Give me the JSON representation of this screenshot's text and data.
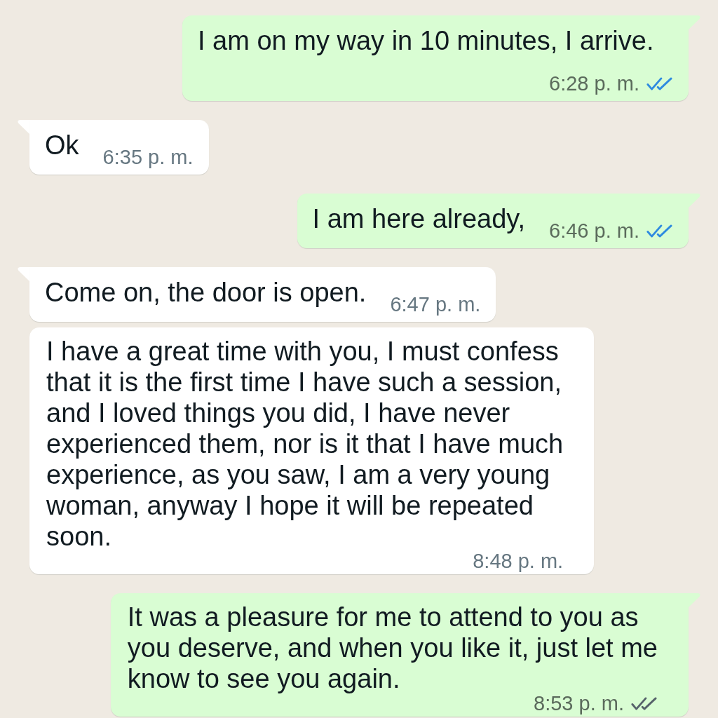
{
  "messages": [
    {
      "kind": "outgoing",
      "tail": true,
      "text": "I am on my way in 10 minutes, I arrive.",
      "time": "6:28 p. m.",
      "read": true
    },
    {
      "kind": "incoming",
      "tail": true,
      "text": "Ok",
      "time": "6:35 p. m."
    },
    {
      "kind": "outgoing",
      "tail": true,
      "text": "I am here already,",
      "time": "6:46 p. m.",
      "read": true
    },
    {
      "kind": "incoming",
      "tail": true,
      "text": "Come on, the door is open.",
      "time": "6:47 p. m."
    },
    {
      "kind": "incoming",
      "tail": false,
      "text": "I have a great time with you, I must confess\nthat it is the first time I have such a session,\nand I loved things you did, I have never\nexperienced them, nor is it that I have much\nexperience, as you saw, I am a very young\nwoman, anyway I hope it will be repeated\nsoon.",
      "time": "8:48 p. m."
    },
    {
      "kind": "outgoing",
      "tail": true,
      "text": "It was a pleasure for me to attend to you as\nyou deserve, and when you like it, just let me\nknow to see you again.",
      "time": "8:53 p. m.",
      "read": false
    }
  ]
}
